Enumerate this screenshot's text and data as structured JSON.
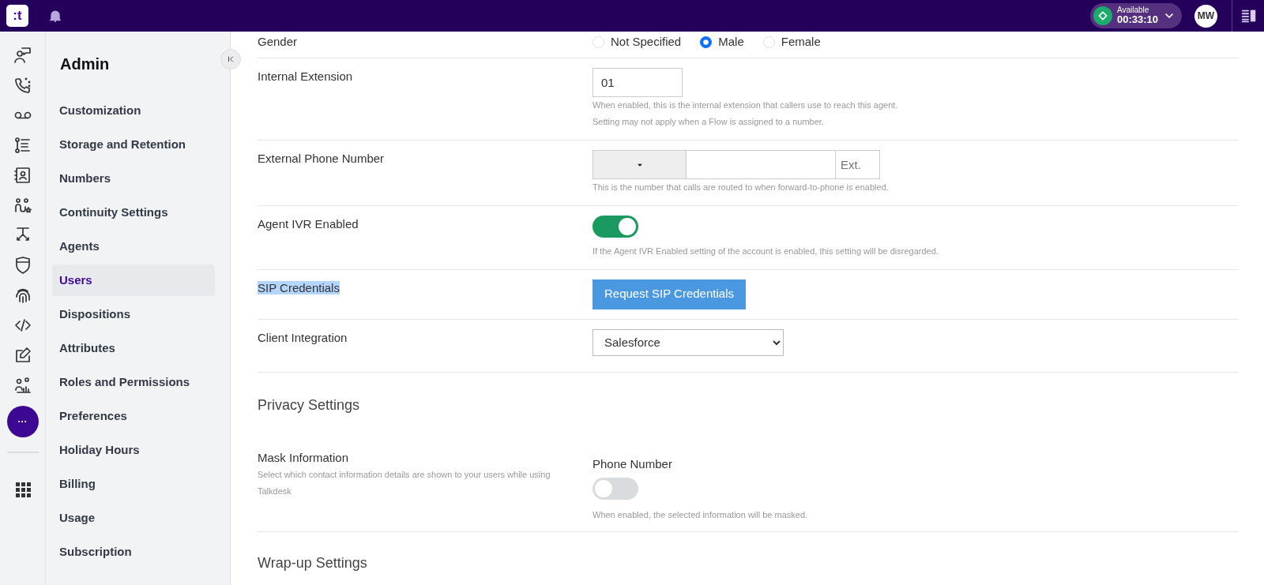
{
  "topbar": {
    "logo": ":t",
    "status": {
      "label": "Available",
      "time": "00:33:10"
    },
    "avatar": "MW"
  },
  "rail": {
    "more": "···"
  },
  "sidebar": {
    "title": "Admin",
    "items": [
      {
        "label": "Customization",
        "selected": false
      },
      {
        "label": "Storage and Retention",
        "selected": false
      },
      {
        "label": "Numbers",
        "selected": false
      },
      {
        "label": "Continuity Settings",
        "selected": false
      },
      {
        "label": "Agents",
        "selected": false
      },
      {
        "label": "Users",
        "selected": true
      },
      {
        "label": "Dispositions",
        "selected": false
      },
      {
        "label": "Attributes",
        "selected": false
      },
      {
        "label": "Roles and Permissions",
        "selected": false
      },
      {
        "label": "Preferences",
        "selected": false
      },
      {
        "label": "Holiday Hours",
        "selected": false
      },
      {
        "label": "Billing",
        "selected": false
      },
      {
        "label": "Usage",
        "selected": false
      },
      {
        "label": "Subscription",
        "selected": false
      }
    ]
  },
  "form": {
    "fields": [
      {
        "kind": "radio",
        "label": "Gender",
        "options": [
          {
            "label": "Not Specified",
            "selected": false
          },
          {
            "label": "Male",
            "selected": true
          },
          {
            "label": "Female",
            "selected": false
          }
        ]
      },
      {
        "kind": "text",
        "label": "Internal Extension",
        "value": "01",
        "hints": [
          "When enabled, this is the internal extension that callers use to reach this agent.",
          "Setting may not apply when a Flow is assigned to a number."
        ]
      },
      {
        "kind": "phone",
        "label": "External Phone Number",
        "ext_placeholder": "Ext.",
        "hints": [
          "This is the number that calls are routed to when forward-to-phone is enabled."
        ]
      },
      {
        "kind": "toggle",
        "label": "Agent IVR Enabled",
        "on": true,
        "hints": [
          "If the Agent IVR Enabled setting of the account is enabled, this setting will be disregarded."
        ]
      },
      {
        "kind": "button",
        "label": "SIP Credentials",
        "highlighted": true,
        "button": "Request SIP Credentials"
      },
      {
        "kind": "select",
        "label": "Client Integration",
        "value": "Salesforce"
      }
    ]
  },
  "privacy": {
    "heading": "Privacy Settings",
    "label": "Mask Information",
    "description": "Select which contact information details are shown to your users while using Talkdesk",
    "option": "Phone Number",
    "on": false,
    "hint": "When enabled, the selected information will be masked."
  },
  "wrapup": {
    "heading": "Wrap-up Settings"
  }
}
